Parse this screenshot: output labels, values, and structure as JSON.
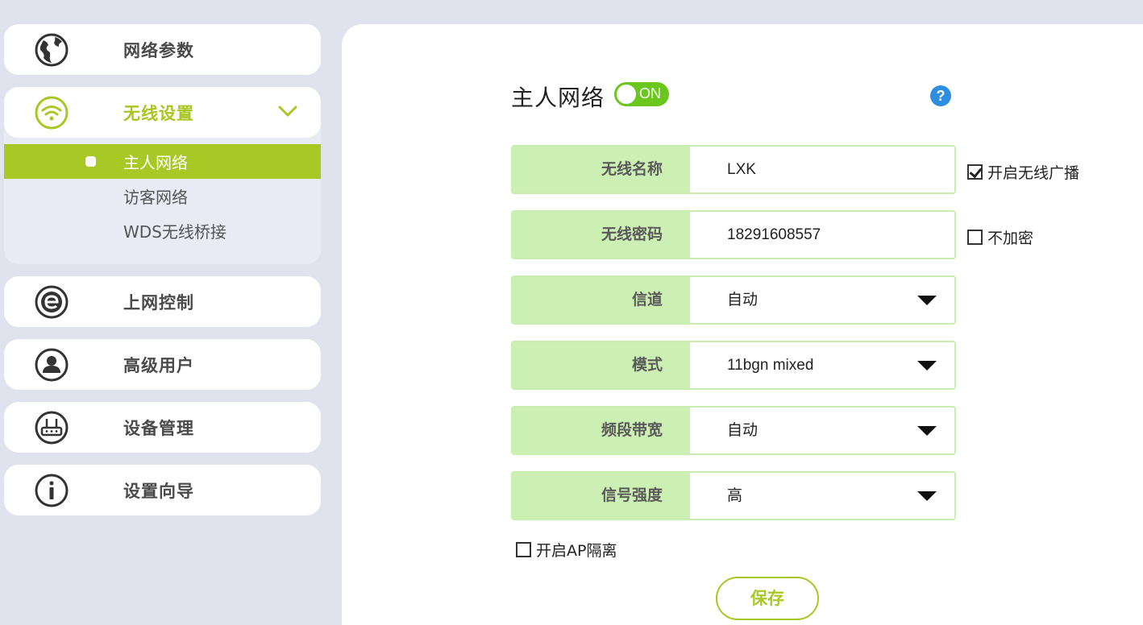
{
  "sidebar": {
    "items": [
      {
        "label": "网络参数",
        "icon": "globe-icon"
      },
      {
        "label": "无线设置",
        "icon": "wifi-icon"
      },
      {
        "label": "上网控制",
        "icon": "internet-e-icon"
      },
      {
        "label": "高级用户",
        "icon": "user-icon"
      },
      {
        "label": "设备管理",
        "icon": "router-icon"
      },
      {
        "label": "设置向导",
        "icon": "info-icon"
      }
    ],
    "wireless_sub": [
      {
        "label": "主人网络",
        "active": true
      },
      {
        "label": "访客网络"
      },
      {
        "label": "WDS无线桥接"
      }
    ]
  },
  "main": {
    "title": "主人网络",
    "toggle_label": "ON",
    "help_label": "?",
    "fields": [
      {
        "label": "无线名称",
        "value": "LXK"
      },
      {
        "label": "无线密码",
        "value": "18291608557"
      },
      {
        "label": "信道",
        "value": "自动"
      },
      {
        "label": "模式",
        "value": "11bgn mixed"
      },
      {
        "label": "频段带宽",
        "value": "自动"
      },
      {
        "label": "信号强度",
        "value": "高"
      }
    ],
    "checkboxes": {
      "broadcast": {
        "label": "开启无线广播",
        "checked": true
      },
      "no_encrypt": {
        "label": "不加密",
        "checked": false
      },
      "ap_isolation": {
        "label": "开启AP隔离",
        "checked": false
      }
    },
    "save_label": "保存"
  },
  "colors": {
    "accent": "#a8c925",
    "toggle": "#6bc61e",
    "label_bg": "#ccf0b3",
    "help": "#2e8fe0"
  }
}
